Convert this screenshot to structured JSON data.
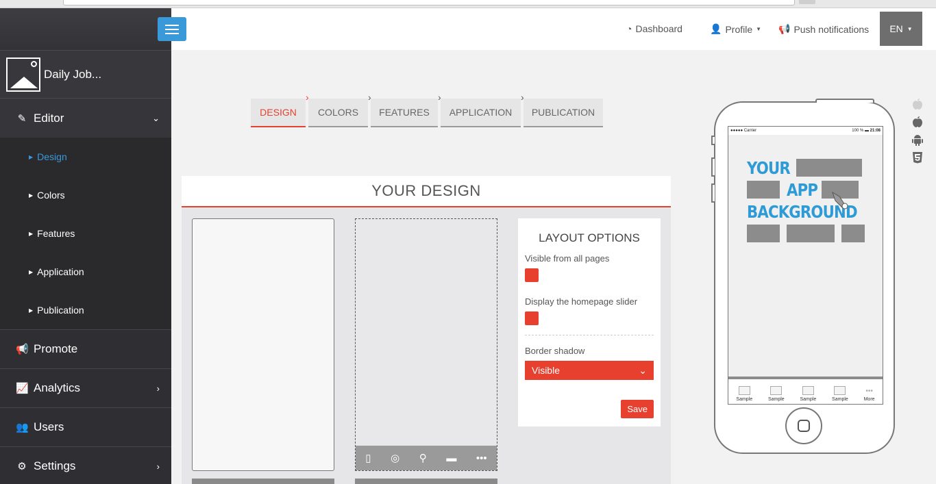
{
  "sidebar": {
    "app_name": "Daily Job...",
    "menu": {
      "editor": "Editor",
      "promote": "Promote",
      "analytics": "Analytics",
      "users": "Users",
      "settings": "Settings"
    },
    "submenu": [
      "Design",
      "Colors",
      "Features",
      "Application",
      "Publication"
    ]
  },
  "topnav": {
    "dashboard": "Dashboard",
    "profile": "Profile",
    "push": "Push notifications",
    "lang": "EN"
  },
  "steps": [
    "DESIGN",
    "COLORS",
    "FEATURES",
    "APPLICATION",
    "PUBLICATION"
  ],
  "design": {
    "title": "YOUR DESIGN"
  },
  "layout_options": {
    "title": "LAYOUT OPTIONS",
    "visible_all_pages": "Visible from all pages",
    "homepage_slider": "Display the homepage slider",
    "border_shadow": "Border shadow",
    "border_shadow_value": "Visible",
    "save": "Save"
  },
  "phone": {
    "carrier": "●●●●● Carrier",
    "battery": "100 %",
    "time": "21:08",
    "bg_words": [
      "YOUR",
      "APP",
      "BACKGROUND"
    ],
    "tabs": [
      "Sample",
      "Sample",
      "Sample",
      "Sample",
      "More"
    ]
  },
  "colors": {
    "accent": "#e8402f",
    "sidebar": "#2f2f33",
    "highlight": "#3a9ad9"
  }
}
